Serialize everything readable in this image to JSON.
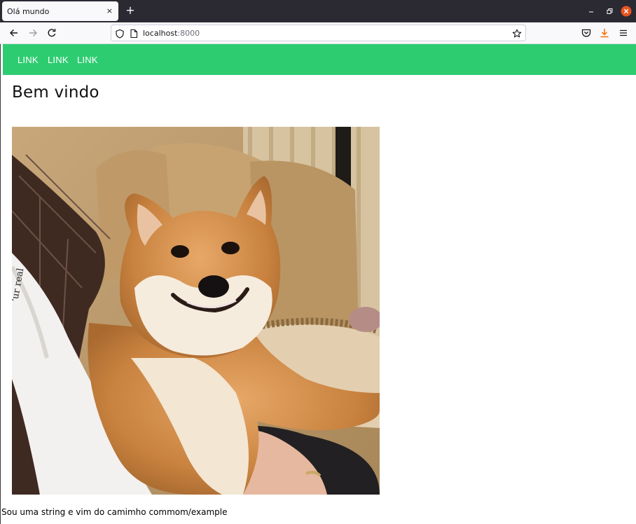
{
  "browser": {
    "tab_title": "Olá mundo",
    "tab_close_glyph": "×",
    "new_tab_glyph": "+",
    "url_host": "localhost",
    "url_port": ":8000",
    "icons": [
      "back-icon",
      "forward-icon",
      "reload-icon",
      "shield-icon",
      "page-icon",
      "bookmark-star-icon",
      "pocket-icon",
      "download-icon",
      "menu-icon",
      "minimize-icon",
      "restore-icon",
      "close-icon"
    ],
    "colors": {
      "chrome_dark": "#2b2a33",
      "toolbar": "#f9f9fb",
      "download_accent": "#ff6a00",
      "close_button": "#e95420"
    }
  },
  "page": {
    "nav_color": "#2ecc71",
    "nav_links": [
      "LINK",
      "LINK",
      "LINK"
    ],
    "heading": "Bem vindo",
    "image": {
      "subject": "smiling shiba inu dog on a couch"
    },
    "footer_text": "Sou uma string e vim do camimho commom/example"
  }
}
